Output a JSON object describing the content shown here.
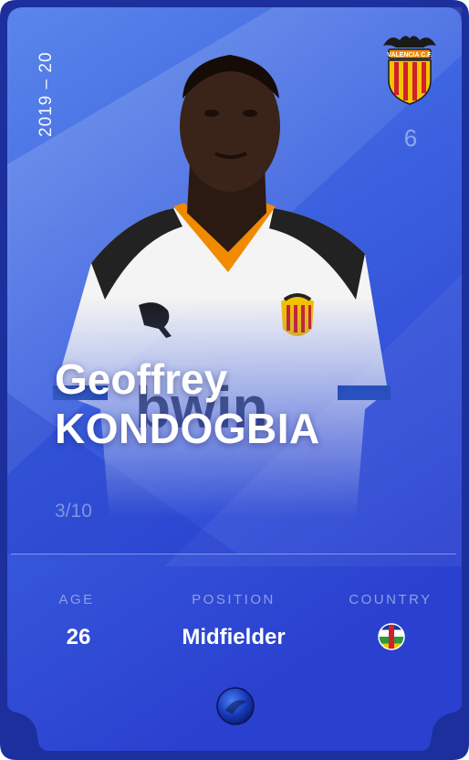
{
  "card": {
    "season": "2019 – 20",
    "club_name": "VALENCIA C.F.",
    "jersey_number": "6",
    "player": {
      "first_name": "Geoffrey",
      "last_name": "KONDOGBIA"
    },
    "edition": "3/10",
    "stats": {
      "age_label": "AGE",
      "age_value": "26",
      "position_label": "POSITION",
      "position_value": "Midfielder",
      "country_label": "COUNTRY"
    },
    "colors": {
      "card_blue": "#3a5fe0",
      "card_frame": "#1b2f9a",
      "crest_orange": "#f08a00",
      "crest_yellow": "#f5c400",
      "crest_red": "#d0202e"
    },
    "icons": {
      "crest": "valencia-crest-icon",
      "flag": "central-african-republic-flag-icon",
      "rarity": "rare-gem-icon"
    }
  }
}
